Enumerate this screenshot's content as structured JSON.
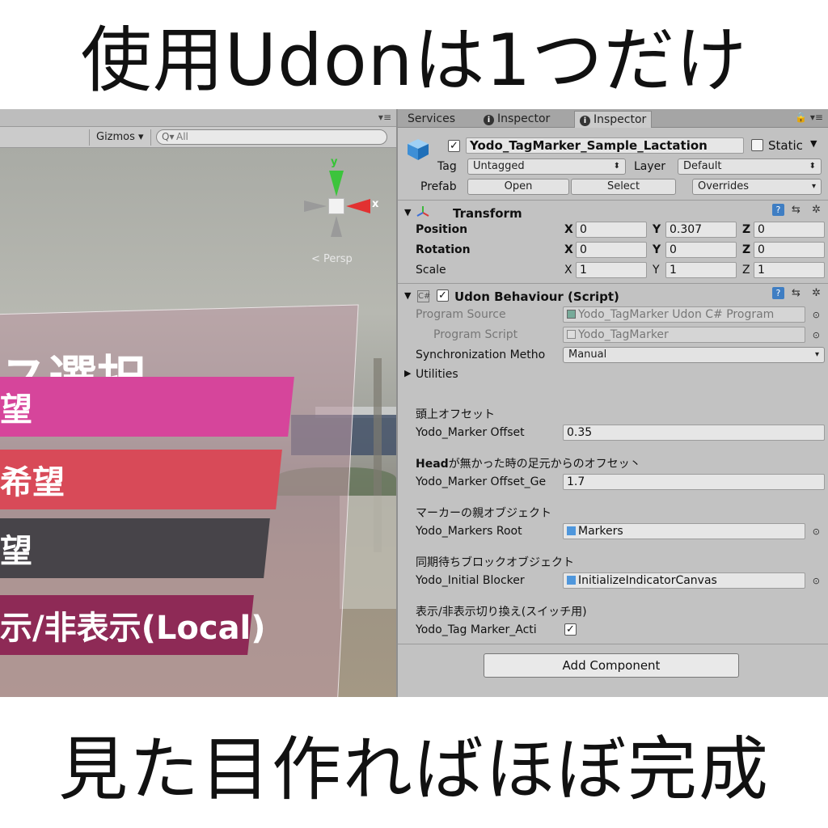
{
  "top_caption": "使用Udonは1つだけ",
  "bottom_caption": "見た目作ればほぼ完成",
  "scene": {
    "gizmos_label": "Gizmos",
    "search_placeholder": "All",
    "axis_y": "y",
    "axis_x": "x",
    "projection_label": "Persp",
    "menu_title": "ス選択",
    "menu_buttons": [
      {
        "label": "望",
        "color": "#d6459b"
      },
      {
        "label": "希望",
        "color": "#d84a58"
      },
      {
        "label": "望",
        "color": "#474449"
      },
      {
        "label": "示/非表示(Local)",
        "color": "#8e2a56"
      }
    ]
  },
  "inspector": {
    "tabs": [
      "Services",
      "Inspector",
      "Inspector"
    ],
    "object_name": "Yodo_TagMarker_Sample_Lactation",
    "static_label": "Static",
    "tag_label": "Tag",
    "tag_value": "Untagged",
    "layer_label": "Layer",
    "layer_value": "Default",
    "prefab_label": "Prefab",
    "prefab_open": "Open",
    "prefab_select": "Select",
    "prefab_overrides": "Overrides",
    "transform": {
      "title": "Transform",
      "position_label": "Position",
      "rotation_label": "Rotation",
      "scale_label": "Scale",
      "axis_x": "X",
      "axis_y": "Y",
      "axis_z": "Z",
      "position": [
        "0",
        "0.307",
        "0"
      ],
      "rotation": [
        "0",
        "0",
        "0"
      ],
      "scale": [
        "1",
        "1",
        "1"
      ]
    },
    "udon": {
      "title": "Udon Behaviour (Script)",
      "program_source_label": "Program Source",
      "program_source_value": "Yodo_TagMarker Udon C# Program",
      "program_script_label": "Program Script",
      "program_script_value": "Yodo_TagMarker",
      "sync_label": "Synchronization Metho",
      "sync_value": "Manual",
      "utilities_label": "Utilities",
      "header1": "頭上オフセット",
      "marker_offset_label": "Yodo_Marker Offset",
      "marker_offset_value": "0.35",
      "header2_bold": "Head",
      "header2_rest": "が無かった時の足元からのオフセッ丶",
      "marker_offset_ge_label": "Yodo_Marker Offset_Ge",
      "marker_offset_ge_value": "1.7",
      "header3": "マーカーの親オブジェクト",
      "markers_root_label": "Yodo_Markers Root",
      "markers_root_value": "Markers",
      "header4": "同期待ちブロックオブジェクト",
      "initial_blocker_label": "Yodo_Initial Blocker",
      "initial_blocker_value": "InitializeIndicatorCanvas",
      "header5": "表示/非表示切り換え(スイッチ用)",
      "active_label": "Yodo_Tag Marker_Acti"
    },
    "add_component": "Add Component"
  }
}
